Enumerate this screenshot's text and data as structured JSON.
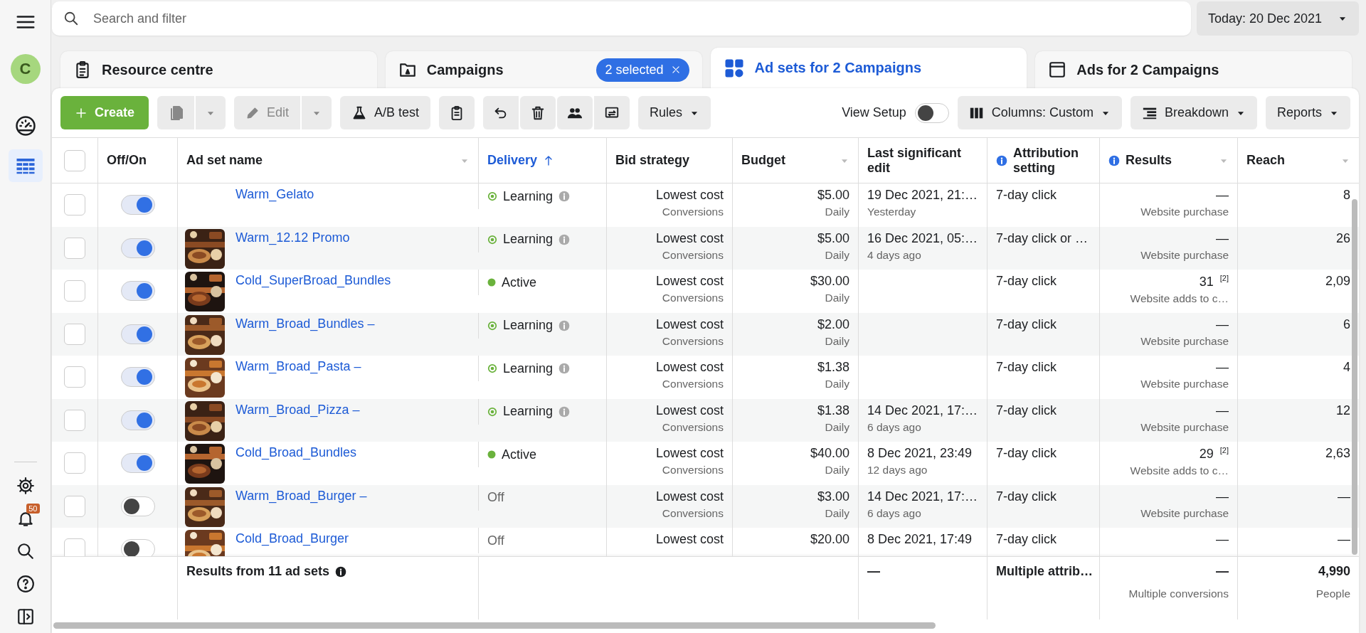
{
  "sidebar": {
    "avatar": "C",
    "notification_count": "50",
    "nav": [
      {
        "kind": "gauge",
        "selected": false
      },
      {
        "kind": "table",
        "selected": true
      }
    ]
  },
  "search": {
    "placeholder": "Search and filter"
  },
  "date_button": "Today: 20 Dec 2021",
  "tabs": [
    {
      "kind": "clipboard",
      "label": "Resource centre",
      "selected": false
    },
    {
      "kind": "folder",
      "label": "Campaigns",
      "selected": false,
      "badge": "2 selected"
    },
    {
      "kind": "grid",
      "label": "Ad sets for 2 Campaigns",
      "selected": true
    },
    {
      "kind": "window",
      "label": "Ads for 2 Campaigns",
      "selected": false
    }
  ],
  "toolbar": {
    "create": "Create",
    "duplicate_disabled": true,
    "edit": "Edit",
    "edit_disabled": true,
    "ab_test": "A/B test",
    "rules": "Rules",
    "view_setup": {
      "label": "View Setup",
      "on": false
    },
    "columns": "Columns: Custom",
    "breakdown": "Breakdown",
    "reports": "Reports"
  },
  "table": {
    "all_checked": false,
    "columns": [
      {
        "label": "Off/On"
      },
      {
        "label": "Ad set name",
        "menu": true
      },
      {
        "label": "Delivery",
        "sorted": true
      },
      {
        "label": "Bid strategy"
      },
      {
        "label": "Budget",
        "menu": true
      },
      {
        "label": "Last significant edit"
      },
      {
        "label": "Attribution setting",
        "info": true
      },
      {
        "label": "Results",
        "menu": true,
        "info": true
      },
      {
        "label": "Reach",
        "menu": true
      }
    ],
    "rows": [
      {
        "checked": false,
        "on": true,
        "name": "Warm_Gelato",
        "delivery": {
          "kind": "learning",
          "label": "Learning"
        },
        "bid": "Lowest cost",
        "bid_sub": "Conversions",
        "budget": "$5.00",
        "budget_sub": "Daily",
        "edit": "19 Dec 2021, 21:…",
        "edit_sub": "Yesterday",
        "attribution": "7-day click",
        "results": "—",
        "results_sub": "Website purchase",
        "reach": "8"
      },
      {
        "checked": false,
        "on": true,
        "name": "Warm_12.12 Promo",
        "delivery": {
          "kind": "learning",
          "label": "Learning"
        },
        "bid": "Lowest cost",
        "bid_sub": "Conversions",
        "budget": "$5.00",
        "budget_sub": "Daily",
        "edit": "16 Dec 2021, 05:…",
        "edit_sub": "4 days ago",
        "attribution": "7-day click or …",
        "results": "—",
        "results_sub": "Website purchase",
        "reach": "26"
      },
      {
        "checked": false,
        "on": true,
        "name": "Cold_SuperBroad_Bundles",
        "delivery": {
          "kind": "active",
          "label": "Active"
        },
        "bid": "Lowest cost",
        "bid_sub": "Conversions",
        "budget": "$30.00",
        "budget_sub": "Daily",
        "attribution": "7-day click",
        "results": "31 $^{[2]}$",
        "results_sub": "Website adds to c…",
        "reach": "2,09"
      },
      {
        "checked": false,
        "on": true,
        "name": "Warm_Broad_Bundles –",
        "delivery": {
          "kind": "learning",
          "label": "Learning"
        },
        "bid": "Lowest cost",
        "bid_sub": "Conversions",
        "budget": "$2.00",
        "budget_sub": "Daily",
        "attribution": "7-day click",
        "results": "—",
        "results_sub": "Website purchase",
        "reach": "6"
      },
      {
        "checked": false,
        "on": true,
        "name": "Warm_Broad_Pasta –",
        "delivery": {
          "kind": "learning",
          "label": "Learning"
        },
        "bid": "Lowest cost",
        "bid_sub": "Conversions",
        "budget": "$1.38",
        "budget_sub": "Daily",
        "attribution": "7-day click",
        "results": "—",
        "results_sub": "Website purchase",
        "reach": "4"
      },
      {
        "checked": false,
        "on": true,
        "name": "Warm_Broad_Pizza –",
        "delivery": {
          "kind": "learning",
          "label": "Learning"
        },
        "bid": "Lowest cost",
        "bid_sub": "Conversions",
        "budget": "$1.38",
        "budget_sub": "Daily",
        "edit": "14 Dec 2021, 17:…",
        "edit_sub": "6 days ago",
        "attribution": "7-day click",
        "results": "—",
        "results_sub": "Website purchase",
        "reach": "12"
      },
      {
        "checked": false,
        "on": true,
        "name": "Cold_Broad_Bundles",
        "delivery": {
          "kind": "active",
          "label": "Active"
        },
        "bid": "Lowest cost",
        "bid_sub": "Conversions",
        "budget": "$40.00",
        "budget_sub": "Daily",
        "edit": "8 Dec 2021, 23:49",
        "edit_sub": "12 days ago",
        "attribution": "7-day click",
        "results": "29 $^{[2]}$",
        "results_sub": "Website adds to c…",
        "reach": "2,63"
      },
      {
        "checked": false,
        "on": false,
        "name": "Warm_Broad_Burger –",
        "delivery": {
          "kind": "off",
          "label": "Off"
        },
        "bid": "Lowest cost",
        "bid_sub": "Conversions",
        "budget": "$3.00",
        "budget_sub": "Daily",
        "edit": "14 Dec 2021, 17:…",
        "edit_sub": "6 days ago",
        "attribution": "7-day click",
        "results": "—",
        "results_sub": "Website purchase",
        "reach": "—"
      },
      {
        "checked": false,
        "on": false,
        "name": "Cold_Broad_Burger",
        "delivery": {
          "kind": "off",
          "label": "Off"
        },
        "bid": "Lowest cost",
        "budget": "$20.00",
        "edit": "8 Dec 2021, 17:49",
        "attribution": "7-day click",
        "results": "—",
        "reach": "—"
      }
    ],
    "footer": {
      "label": "Results from 11 ad sets",
      "last_edit": "—",
      "attribution": "Multiple attrib…",
      "results": "—",
      "results_sub": "Multiple conversions",
      "reach": "4,990",
      "reach_sub": "People"
    }
  }
}
